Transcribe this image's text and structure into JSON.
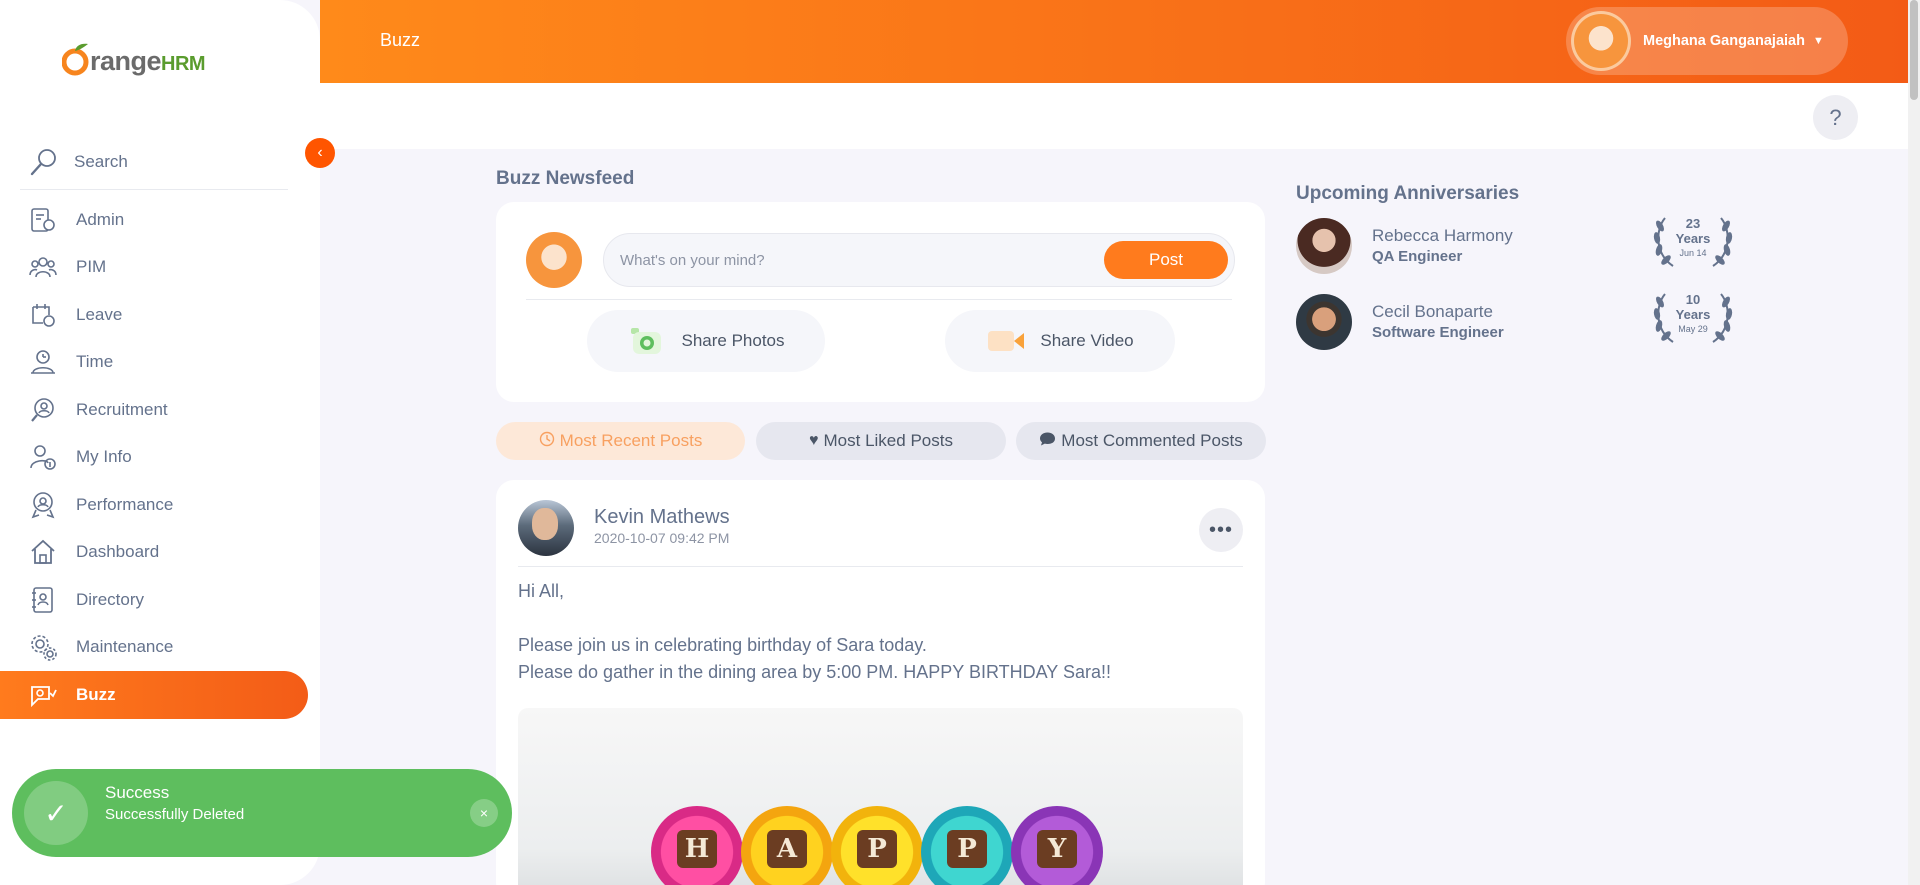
{
  "header": {
    "title": "Buzz",
    "user_name": "Meghana Ganganajaiah",
    "help_label": "?"
  },
  "sidebar": {
    "logo_o": "O",
    "logo_range": "range",
    "logo_hrm": "HRM",
    "search_label": "Search",
    "items": [
      {
        "label": "Admin",
        "icon": "admin-icon"
      },
      {
        "label": "PIM",
        "icon": "pim-icon"
      },
      {
        "label": "Leave",
        "icon": "leave-icon"
      },
      {
        "label": "Time",
        "icon": "time-icon"
      },
      {
        "label": "Recruitment",
        "icon": "recruitment-icon"
      },
      {
        "label": "My Info",
        "icon": "my-info-icon"
      },
      {
        "label": "Performance",
        "icon": "performance-icon"
      },
      {
        "label": "Dashboard",
        "icon": "dashboard-icon"
      },
      {
        "label": "Directory",
        "icon": "directory-icon"
      },
      {
        "label": "Maintenance",
        "icon": "maintenance-icon"
      },
      {
        "label": "Buzz",
        "icon": "buzz-icon",
        "active": true
      }
    ]
  },
  "main": {
    "title": "Buzz Newsfeed",
    "composer": {
      "placeholder": "What's on your mind?",
      "post_label": "Post",
      "share_photos": "Share Photos",
      "share_video": "Share Video"
    },
    "tabs": [
      {
        "label": "Most Recent Posts",
        "active": true
      },
      {
        "label": "Most Liked Posts"
      },
      {
        "label": "Most Commented Posts"
      }
    ],
    "post": {
      "author": "Kevin Mathews",
      "timestamp": "2020-10-07 09:42 PM",
      "line1": "Hi All,",
      "line2": "Please join us in celebrating birthday of Sara today.",
      "line3": "Please do gather in the dining area by 5:00 PM. HAPPY BIRTHDAY Sara!!",
      "image_letters": [
        "H",
        "A",
        "P",
        "P",
        "Y"
      ]
    }
  },
  "anniversaries": {
    "title": "Upcoming Anniversaries",
    "items": [
      {
        "name": "Rebecca Harmony",
        "job": "QA Engineer",
        "years": "23",
        "years_label": "Years",
        "date": "Jun 14"
      },
      {
        "name": "Cecil Bonaparte",
        "job": "Software Engineer",
        "years": "10",
        "years_label": "Years",
        "date": "May 29"
      }
    ]
  },
  "toast": {
    "title": "Success",
    "message": "Successfully Deleted",
    "close": "×"
  },
  "colors": {
    "brand_orange": "#ff7b1d",
    "success_green": "#5ebe5e",
    "text": "#64728c"
  }
}
